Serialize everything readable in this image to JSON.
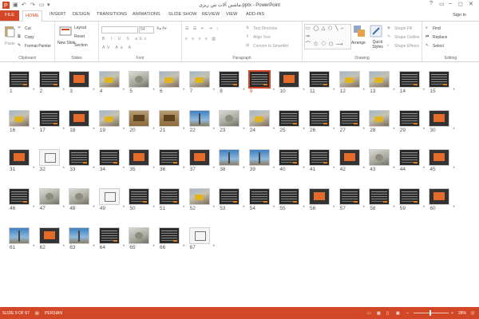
{
  "window": {
    "title": "ماشین آلات بتن ریزی.pptx - PowerPoint",
    "win_controls": [
      "?",
      "▭",
      "–",
      "◻",
      "✕"
    ]
  },
  "tabs": [
    "FILE",
    "HOME",
    "INSERT",
    "DESIGN",
    "TRANSITIONS",
    "ANIMATIONS",
    "SLIDE SHOW",
    "REVIEW",
    "VIEW",
    "ADD-INS"
  ],
  "active_tab": "HOME",
  "sign_in": "Sign in",
  "ribbon": {
    "clipboard": {
      "label": "Clipboard",
      "paste": "Paste",
      "cut": "Cut",
      "copy": "Copy",
      "format_painter": "Format Painter"
    },
    "slides": {
      "label": "Slides",
      "new_slide": "New Slide",
      "layout": "Layout",
      "reset": "Reset",
      "section": "Section"
    },
    "font": {
      "label": "Font",
      "size": "54"
    },
    "paragraph": {
      "label": "Paragraph",
      "text_direction": "Text Direction",
      "align_text": "Align Text",
      "convert_smartart": "Convert to SmartArt"
    },
    "drawing": {
      "label": "Drawing",
      "arrange": "Arrange",
      "quick_styles": "Quick Styles",
      "shape_fill": "Shape Fill",
      "shape_outline": "Shape Outline",
      "shape_effects": "Shape Effects"
    },
    "editing": {
      "label": "Editing",
      "find": "Find",
      "replace": "Replace",
      "select": "Select"
    }
  },
  "slides": {
    "star": "*",
    "selected": "9",
    "items": [
      {
        "n": "1",
        "t": "dark"
      },
      {
        "n": "2",
        "t": "dark"
      },
      {
        "n": "3",
        "t": "orange"
      },
      {
        "n": "4",
        "t": "photo"
      },
      {
        "n": "5",
        "t": "grey"
      },
      {
        "n": "6",
        "t": "photo"
      },
      {
        "n": "7",
        "t": "photo"
      },
      {
        "n": "8",
        "t": "dark"
      },
      {
        "n": "9",
        "t": "dark"
      },
      {
        "n": "10",
        "t": "orange"
      },
      {
        "n": "11",
        "t": "dark"
      },
      {
        "n": "12",
        "t": "photo"
      },
      {
        "n": "13",
        "t": "photo"
      },
      {
        "n": "14",
        "t": "dark"
      },
      {
        "n": "15",
        "t": "dark"
      },
      {
        "n": "16",
        "t": "photo"
      },
      {
        "n": "17",
        "t": "dark"
      },
      {
        "n": "18",
        "t": "orange"
      },
      {
        "n": "19",
        "t": "photo"
      },
      {
        "n": "20",
        "t": "brown"
      },
      {
        "n": "21",
        "t": "brown"
      },
      {
        "n": "22",
        "t": "sky"
      },
      {
        "n": "23",
        "t": "grey"
      },
      {
        "n": "24",
        "t": "photo"
      },
      {
        "n": "25",
        "t": "dark"
      },
      {
        "n": "26",
        "t": "dark"
      },
      {
        "n": "27",
        "t": "dark"
      },
      {
        "n": "28",
        "t": "photo"
      },
      {
        "n": "29",
        "t": "dark"
      },
      {
        "n": "30",
        "t": "orange"
      },
      {
        "n": "31",
        "t": "orange"
      },
      {
        "n": "32",
        "t": "white"
      },
      {
        "n": "33",
        "t": "dark"
      },
      {
        "n": "34",
        "t": "dark"
      },
      {
        "n": "35",
        "t": "orange"
      },
      {
        "n": "36",
        "t": "dark"
      },
      {
        "n": "37",
        "t": "orange"
      },
      {
        "n": "38",
        "t": "sky"
      },
      {
        "n": "39",
        "t": "sky"
      },
      {
        "n": "40",
        "t": "dark"
      },
      {
        "n": "41",
        "t": "dark"
      },
      {
        "n": "42",
        "t": "orange"
      },
      {
        "n": "43",
        "t": "grey"
      },
      {
        "n": "44",
        "t": "dark"
      },
      {
        "n": "45",
        "t": "orange"
      },
      {
        "n": "46",
        "t": "dark"
      },
      {
        "n": "47",
        "t": "grey"
      },
      {
        "n": "48",
        "t": "grey"
      },
      {
        "n": "49",
        "t": "white"
      },
      {
        "n": "50",
        "t": "dark"
      },
      {
        "n": "51",
        "t": "dark"
      },
      {
        "n": "52",
        "t": "photo"
      },
      {
        "n": "53",
        "t": "dark"
      },
      {
        "n": "54",
        "t": "dark"
      },
      {
        "n": "55",
        "t": "dark"
      },
      {
        "n": "56",
        "t": "orange"
      },
      {
        "n": "57",
        "t": "dark"
      },
      {
        "n": "58",
        "t": "dark"
      },
      {
        "n": "59",
        "t": "dark"
      },
      {
        "n": "60",
        "t": "orange"
      },
      {
        "n": "61",
        "t": "sky"
      },
      {
        "n": "62",
        "t": "orange"
      },
      {
        "n": "63",
        "t": "sky"
      },
      {
        "n": "64",
        "t": "dark"
      },
      {
        "n": "65",
        "t": "grey"
      },
      {
        "n": "66",
        "t": "dark"
      },
      {
        "n": "67",
        "t": "white"
      }
    ]
  },
  "status": {
    "slide_info": "SLIDE 9 OF 67",
    "language": "PERSIAN",
    "zoom": "28%"
  },
  "colors": {
    "accent": "#d24726"
  }
}
